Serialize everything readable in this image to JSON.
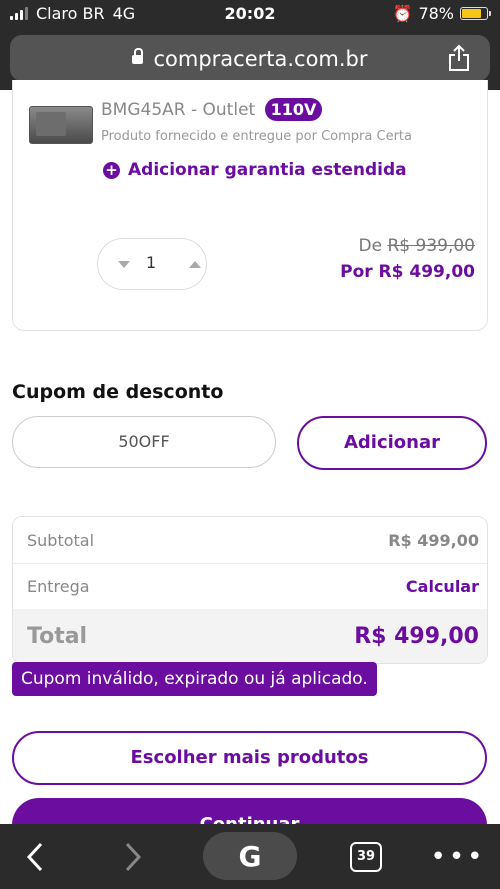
{
  "status_bar": {
    "carrier": "Claro BR",
    "network": "4G",
    "time": "20:02",
    "battery_percent": "78%",
    "battery_level": 0.78
  },
  "browser": {
    "url": "compracerta.com.br",
    "tabs_count": "39",
    "google_label": "G"
  },
  "product": {
    "name": "BMG45AR - Outlet",
    "voltage_badge": "110V",
    "seller_text": "Produto fornecido e entregue por Compra Certa",
    "warranty_link": "Adicionar garantia estendida",
    "quantity": "1",
    "price_from_label": "De",
    "price_from": "R$ 939,00",
    "price_to": "Por R$ 499,00"
  },
  "coupon": {
    "title": "Cupom de desconto",
    "value": "50OFF",
    "add_label": "Adicionar"
  },
  "summary": {
    "subtotal_label": "Subtotal",
    "subtotal_value": "R$ 499,00",
    "delivery_label": "Entrega",
    "delivery_action": "Calcular",
    "total_label": "Total",
    "total_value": "R$ 499,00"
  },
  "error_message": "Cupom inválido, expirado ou já aplicado.",
  "actions": {
    "more_products": "Escolher mais produtos",
    "continue": "Continuar"
  },
  "colors": {
    "brand": "#6b0ea0",
    "chrome": "#2b2b2b",
    "battery": "#f5c518"
  }
}
